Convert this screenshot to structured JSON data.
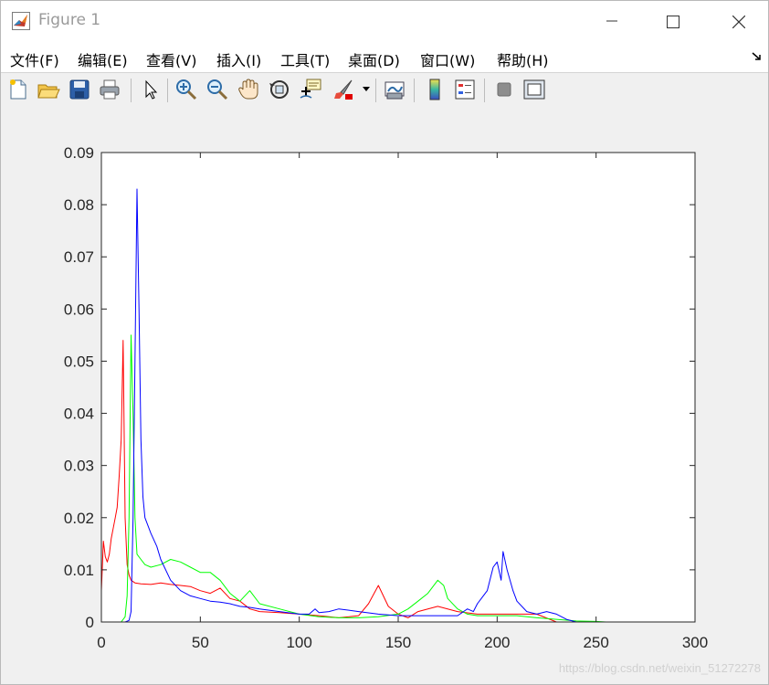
{
  "window": {
    "title": "Figure 1"
  },
  "menu": [
    {
      "label": "文件(F)"
    },
    {
      "label": "编辑(E)"
    },
    {
      "label": "查看(V)"
    },
    {
      "label": "插入(I)"
    },
    {
      "label": "工具(T)"
    },
    {
      "label": "桌面(D)"
    },
    {
      "label": "窗口(W)"
    },
    {
      "label": "帮助(H)"
    }
  ],
  "toolbar": [
    {
      "name": "new-figure-icon"
    },
    {
      "name": "open-file-icon"
    },
    {
      "name": "save-icon"
    },
    {
      "name": "print-icon"
    },
    {
      "name": "select-arrow-icon"
    },
    {
      "name": "zoom-in-icon"
    },
    {
      "name": "zoom-out-icon"
    },
    {
      "name": "pan-hand-icon"
    },
    {
      "name": "rotate-3d-icon"
    },
    {
      "name": "data-cursor-icon"
    },
    {
      "name": "brush-icon"
    },
    {
      "name": "link-plot-icon"
    },
    {
      "name": "colorbar-icon"
    },
    {
      "name": "legend-icon"
    },
    {
      "name": "hide-plot-tools-icon"
    },
    {
      "name": "show-plot-tools-icon"
    }
  ],
  "watermark": "https://blog.csdn.net/weixin_51272278",
  "chart_data": {
    "type": "line",
    "title": "",
    "xlabel": "",
    "ylabel": "",
    "xlim": [
      0,
      300
    ],
    "ylim": [
      0,
      0.09
    ],
    "xticks": [
      0,
      50,
      100,
      150,
      200,
      250,
      300
    ],
    "yticks": [
      0,
      0.01,
      0.02,
      0.03,
      0.04,
      0.05,
      0.06,
      0.07,
      0.08,
      0.09
    ],
    "grid": false,
    "series": [
      {
        "color": "#ff0000",
        "x": [
          0,
          1,
          2,
          3,
          4,
          5,
          6,
          7,
          8,
          9,
          10,
          11,
          12,
          13,
          14,
          15,
          17,
          20,
          25,
          30,
          35,
          40,
          45,
          50,
          55,
          60,
          65,
          70,
          75,
          80,
          90,
          100,
          110,
          120,
          130,
          135,
          140,
          145,
          150,
          155,
          160,
          170,
          180,
          190,
          200,
          210,
          220,
          230
        ],
        "y": [
          0.006,
          0.0155,
          0.0125,
          0.0115,
          0.013,
          0.016,
          0.018,
          0.02,
          0.022,
          0.028,
          0.035,
          0.054,
          0.02,
          0.011,
          0.009,
          0.008,
          0.0075,
          0.0073,
          0.0072,
          0.0075,
          0.0072,
          0.007,
          0.0068,
          0.006,
          0.0055,
          0.0065,
          0.0045,
          0.004,
          0.0025,
          0.002,
          0.0018,
          0.0015,
          0.0012,
          0.0008,
          0.0012,
          0.0035,
          0.007,
          0.003,
          0.0015,
          0.0008,
          0.002,
          0.003,
          0.002,
          0.0015,
          0.0015,
          0.0015,
          0.0015,
          0
        ]
      },
      {
        "color": "#00ff00",
        "x": [
          0,
          10,
          12,
          13,
          14,
          15,
          16,
          17,
          18,
          20,
          22,
          25,
          30,
          35,
          40,
          45,
          50,
          55,
          60,
          65,
          70,
          75,
          80,
          90,
          100,
          110,
          120,
          130,
          140,
          150,
          155,
          160,
          165,
          170,
          173,
          175,
          180,
          185,
          190,
          200,
          210,
          220,
          230,
          240,
          250,
          255
        ],
        "y": [
          0,
          0,
          0.001,
          0.005,
          0.02,
          0.055,
          0.04,
          0.02,
          0.013,
          0.012,
          0.011,
          0.0105,
          0.011,
          0.012,
          0.0115,
          0.0105,
          0.0095,
          0.0095,
          0.008,
          0.0055,
          0.004,
          0.006,
          0.0035,
          0.0025,
          0.0015,
          0.001,
          0.0008,
          0.0008,
          0.001,
          0.0015,
          0.0025,
          0.004,
          0.0055,
          0.008,
          0.007,
          0.0045,
          0.0025,
          0.0015,
          0.0012,
          0.0012,
          0.0012,
          0.0008,
          0.0005,
          0.0002,
          0.0001,
          0
        ]
      },
      {
        "color": "#0000ff",
        "x": [
          0,
          12,
          14,
          15,
          16,
          17,
          18,
          19,
          20,
          21,
          22,
          25,
          28,
          30,
          35,
          40,
          45,
          50,
          55,
          60,
          65,
          70,
          75,
          80,
          90,
          100,
          105,
          108,
          110,
          115,
          120,
          130,
          140,
          150,
          160,
          170,
          180,
          185,
          188,
          190,
          192,
          195,
          198,
          200,
          202,
          203,
          205,
          208,
          210,
          215,
          220,
          225,
          230,
          235,
          240
        ],
        "y": [
          0,
          0,
          0.0003,
          0.002,
          0.02,
          0.05,
          0.083,
          0.06,
          0.035,
          0.024,
          0.02,
          0.017,
          0.0145,
          0.012,
          0.008,
          0.006,
          0.005,
          0.0045,
          0.004,
          0.0038,
          0.0035,
          0.003,
          0.0028,
          0.0025,
          0.002,
          0.0015,
          0.0015,
          0.0025,
          0.0018,
          0.002,
          0.0025,
          0.002,
          0.0015,
          0.0012,
          0.0012,
          0.0012,
          0.0012,
          0.0025,
          0.002,
          0.0035,
          0.0045,
          0.006,
          0.0105,
          0.0115,
          0.008,
          0.0135,
          0.01,
          0.006,
          0.004,
          0.002,
          0.0015,
          0.002,
          0.0015,
          0.0005,
          0
        ]
      }
    ]
  }
}
